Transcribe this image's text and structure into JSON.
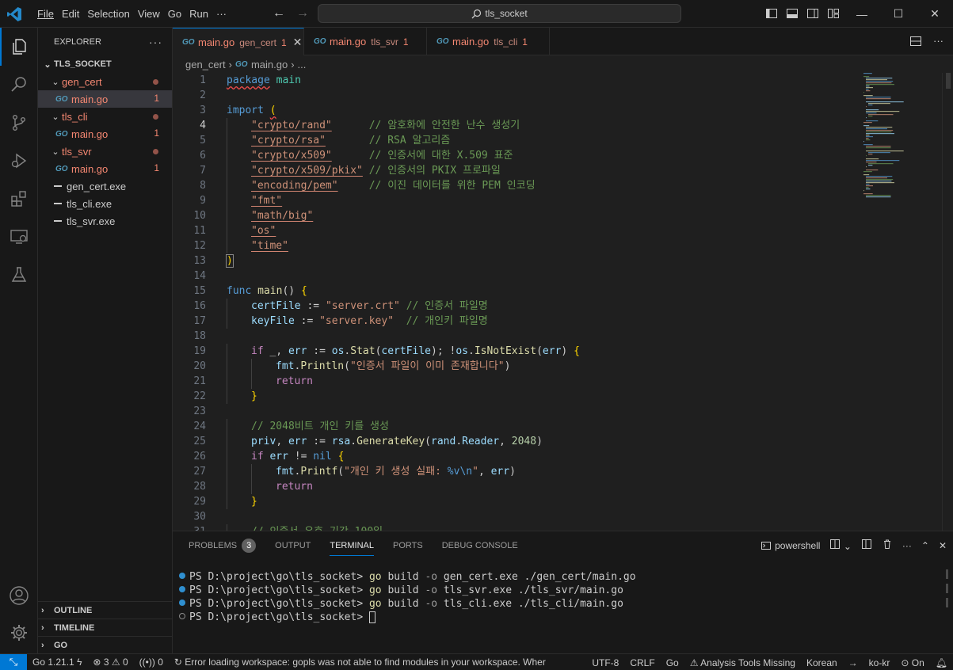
{
  "titlebar": {
    "menu": [
      "File",
      "Edit",
      "Selection",
      "View",
      "Go",
      "Run",
      "···"
    ],
    "search_text": "tls_socket"
  },
  "sidebar": {
    "header": "EXPLORER",
    "root": "TLS_SOCKET",
    "tree": [
      {
        "type": "folder",
        "label": "gen_cert",
        "level": 1,
        "error": true
      },
      {
        "type": "go",
        "label": "main.go",
        "level": 2,
        "count": "1",
        "selected": true
      },
      {
        "type": "folder",
        "label": "tls_cli",
        "level": 1,
        "error": true
      },
      {
        "type": "go",
        "label": "main.go",
        "level": 2,
        "count": "1"
      },
      {
        "type": "folder",
        "label": "tls_svr",
        "level": 1,
        "error": true
      },
      {
        "type": "go",
        "label": "main.go",
        "level": 2,
        "count": "1"
      },
      {
        "type": "file",
        "label": "gen_cert.exe",
        "level": 1
      },
      {
        "type": "file",
        "label": "tls_cli.exe",
        "level": 1
      },
      {
        "type": "file",
        "label": "tls_svr.exe",
        "level": 1
      }
    ],
    "sections": [
      "OUTLINE",
      "TIMELINE",
      "GO"
    ]
  },
  "tabs": [
    {
      "name": "main.go",
      "desc": "gen_cert",
      "count": "1",
      "active": true
    },
    {
      "name": "main.go",
      "desc": "tls_svr",
      "count": "1"
    },
    {
      "name": "main.go",
      "desc": "tls_cli",
      "count": "1"
    }
  ],
  "breadcrumb": {
    "folder": "gen_cert",
    "file": "main.go",
    "more": "..."
  },
  "editor": {
    "current_line": 4,
    "lines": [
      {
        "n": 1,
        "t": "package main"
      },
      {
        "n": 2,
        "t": ""
      },
      {
        "n": 3,
        "t": "import ("
      },
      {
        "n": 4,
        "t": "\"crypto/rand\"      // 암호화에 안전한 난수 생성기"
      },
      {
        "n": 5,
        "t": "\"crypto/rsa\"       // RSA 알고리즘"
      },
      {
        "n": 6,
        "t": "\"crypto/x509\"      // 인증서에 대한 X.509 표준"
      },
      {
        "n": 7,
        "t": "\"crypto/x509/pkix\" // 인증서의 PKIX 프로파일"
      },
      {
        "n": 8,
        "t": "\"encoding/pem\"     // 이진 데이터를 위한 PEM 인코딩"
      },
      {
        "n": 9,
        "t": "\"fmt\""
      },
      {
        "n": 10,
        "t": "\"math/big\""
      },
      {
        "n": 11,
        "t": "\"os\""
      },
      {
        "n": 12,
        "t": "\"time\""
      },
      {
        "n": 13,
        "t": ")"
      },
      {
        "n": 14,
        "t": ""
      },
      {
        "n": 15,
        "t": "func main() {"
      },
      {
        "n": 16,
        "t": "certFile := \"server.crt\" // 인증서 파일명"
      },
      {
        "n": 17,
        "t": "keyFile := \"server.key\"  // 개인키 파일명"
      },
      {
        "n": 18,
        "t": ""
      },
      {
        "n": 19,
        "t": "if _, err := os.Stat(certFile); !os.IsNotExist(err) {"
      },
      {
        "n": 20,
        "t": "fmt.Println(\"인증서 파일이 이미 존재합니다\")"
      },
      {
        "n": 21,
        "t": "return"
      },
      {
        "n": 22,
        "t": "}"
      },
      {
        "n": 23,
        "t": ""
      },
      {
        "n": 24,
        "t": "// 2048비트 개인 키를 생성"
      },
      {
        "n": 25,
        "t": "priv, err := rsa.GenerateKey(rand.Reader, 2048)"
      },
      {
        "n": 26,
        "t": "if err != nil {"
      },
      {
        "n": 27,
        "t": "fmt.Printf(\"개인 키 생성 실패: %v\\n\", err)"
      },
      {
        "n": 28,
        "t": "return"
      },
      {
        "n": 29,
        "t": "}"
      },
      {
        "n": 30,
        "t": ""
      },
      {
        "n": 31,
        "t": "// 인증서 유효 기간 100일"
      }
    ]
  },
  "panel": {
    "tabs": [
      "PROBLEMS",
      "OUTPUT",
      "TERMINAL",
      "PORTS",
      "DEBUG CONSOLE"
    ],
    "problems_count": "3",
    "active_tab": "TERMINAL",
    "shell": "powershell",
    "terminal": [
      {
        "prompt": "PS D:\\project\\go\\tls_socket>",
        "cmd": "go",
        "rest": "build",
        "flag": "-o",
        "args": "gen_cert.exe ./gen_cert/main.go"
      },
      {
        "prompt": "PS D:\\project\\go\\tls_socket>",
        "cmd": "go",
        "rest": "build",
        "flag": "-o",
        "args": "tls_svr.exe ./tls_svr/main.go"
      },
      {
        "prompt": "PS D:\\project\\go\\tls_socket>",
        "cmd": "go",
        "rest": "build",
        "flag": "-o",
        "args": "tls_cli.exe ./tls_cli/main.go"
      },
      {
        "prompt": "PS D:\\project\\go\\tls_socket>",
        "cmd": "",
        "rest": "",
        "flag": "",
        "args": ""
      }
    ]
  },
  "statusbar": {
    "go_version": "Go 1.21.1",
    "errors": "3",
    "warnings": "0",
    "ports": "0",
    "message": "Error loading workspace: gopls was not able to find modules in your workspace. Wher",
    "encoding": "UTF-8",
    "eol": "CRLF",
    "language": "Go",
    "analysis": "Analysis Tools Missing",
    "input_lang": "Korean",
    "locale": "ko-kr",
    "copilot": "On"
  },
  "colors": {
    "accent": "#0078d4",
    "error": "#f48771",
    "bg": "#1f1f1f"
  }
}
